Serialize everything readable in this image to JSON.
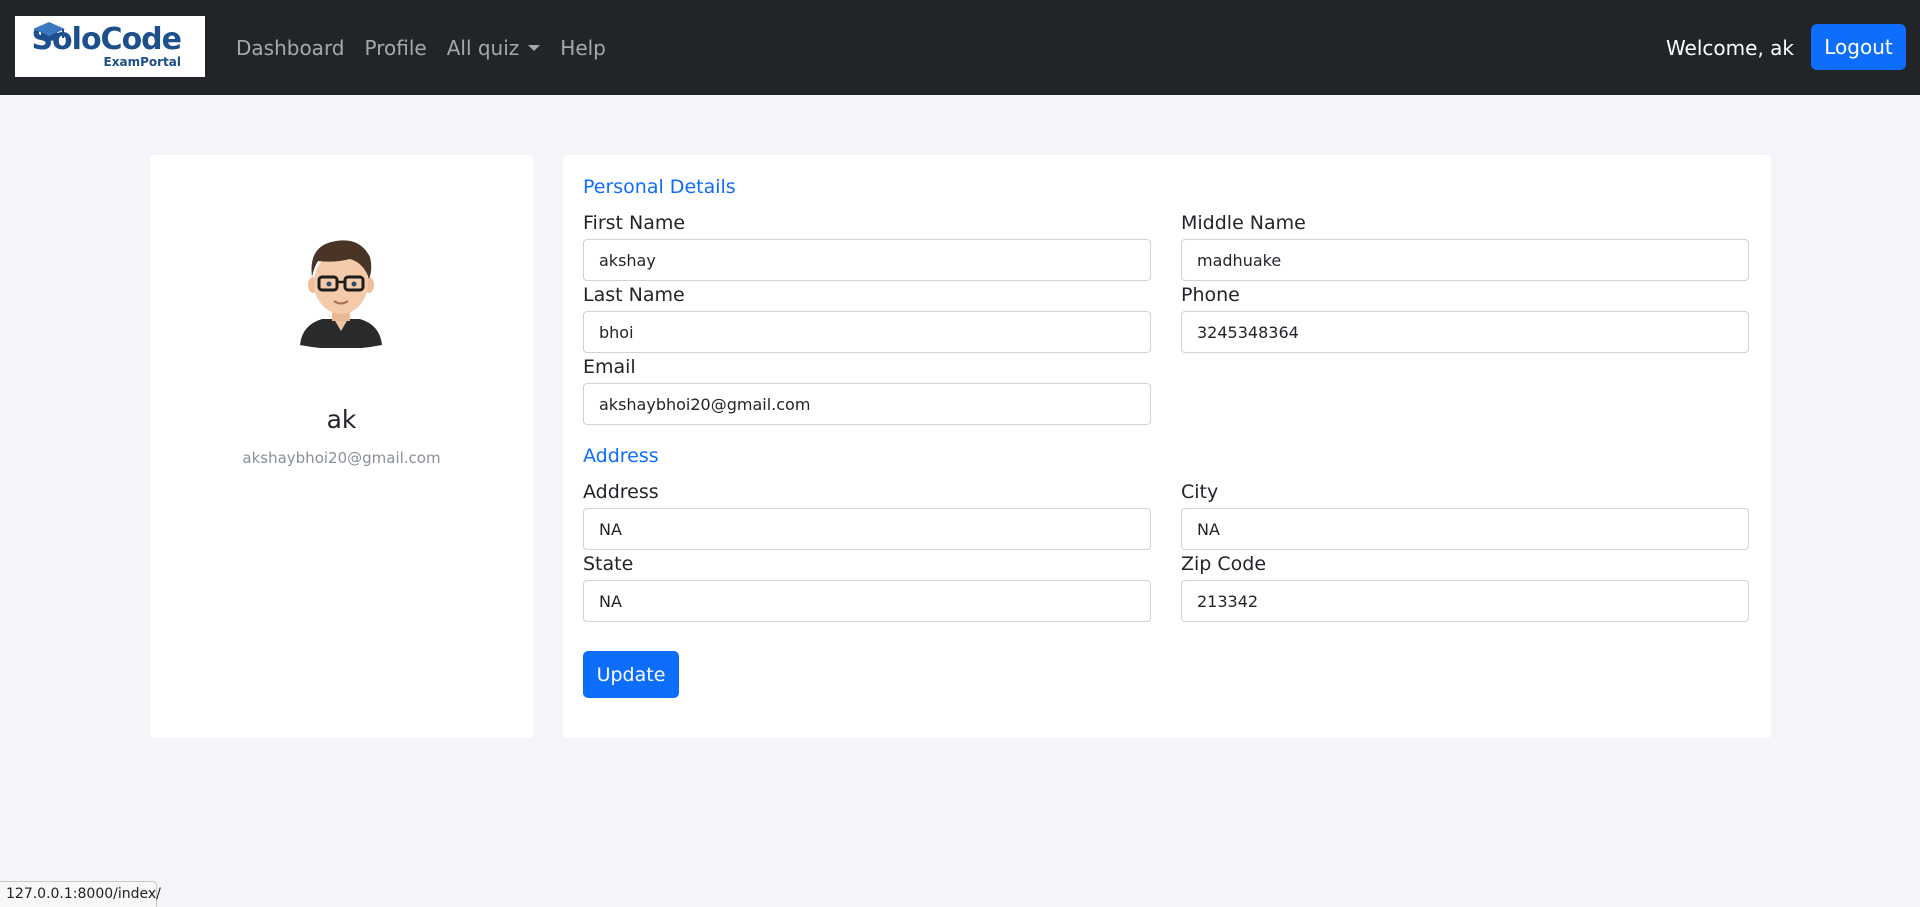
{
  "brand": {
    "name": "SoloCode",
    "subtitle": "ExamPortal"
  },
  "nav": {
    "links": [
      {
        "label": "Dashboard"
      },
      {
        "label": "Profile"
      },
      {
        "label": "All quiz"
      },
      {
        "label": "Help"
      }
    ],
    "welcome": "Welcome, ak",
    "logout_label": "Logout"
  },
  "profile": {
    "name": "ak",
    "email": "akshaybhoi20@gmail.com"
  },
  "personal": {
    "title": "Personal Details",
    "first_name": {
      "label": "First Name",
      "value": "akshay"
    },
    "middle_name": {
      "label": "Middle Name",
      "value": "madhuake"
    },
    "last_name": {
      "label": "Last Name",
      "value": "bhoi"
    },
    "phone": {
      "label": "Phone",
      "value": "3245348364"
    },
    "email": {
      "label": "Email",
      "value": "akshaybhoi20@gmail.com"
    }
  },
  "address": {
    "title": "Address",
    "address": {
      "label": "Address",
      "value": "NA"
    },
    "city": {
      "label": "City",
      "value": "NA"
    },
    "state": {
      "label": "State",
      "value": "NA"
    },
    "zip": {
      "label": "Zip Code",
      "value": "213342"
    }
  },
  "form": {
    "update_label": "Update"
  },
  "status_url": "127.0.0.1:8000/index/",
  "colors": {
    "navbar": "#212529",
    "accent": "#0d6efd",
    "page_bg": "#f4f5f9"
  }
}
